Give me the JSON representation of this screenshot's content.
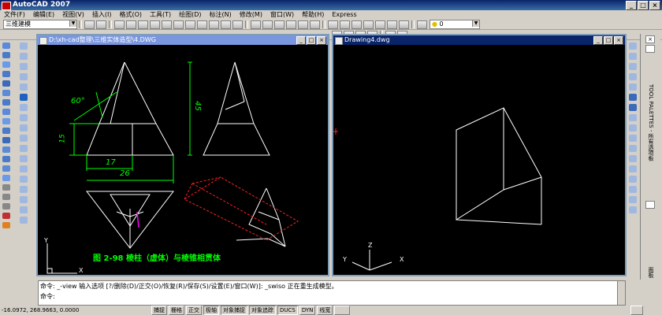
{
  "app": {
    "title": "AutoCAD 2007",
    "min": "_",
    "max": "□",
    "close": "×"
  },
  "menu": [
    "文件(F)",
    "编辑(E)",
    "视图(V)",
    "插入(I)",
    "格式(O)",
    "工具(T)",
    "绘图(D)",
    "标注(N)",
    "修改(M)",
    "窗口(W)",
    "帮助(H)",
    "Express"
  ],
  "toolbar": {
    "workspace": "三维建模",
    "layer": "0"
  },
  "drawing1": {
    "title": "D:\\xh-cad整理\\三维实体造型\\4.DWG",
    "caption": "图 2-98  棱柱（虚体）与棱锥相贯体",
    "dims": {
      "angle": "60°",
      "vertical_45": "45",
      "vertical_15": "15",
      "h17": "17",
      "h26": "26"
    },
    "ucs_y": "Y",
    "ucs_x": "X"
  },
  "drawing2": {
    "title": "Drawing4.dwg",
    "ucs_x": "X",
    "ucs_y": "Y",
    "ucs_z": "Z"
  },
  "right_panel": {
    "tool_palettes": "TOOL PALETTES - 所有选项板",
    "bottom_label": "面板"
  },
  "command": {
    "line1_prompt": "命令:",
    "line1_text": "_-view 输入选项 [?/删除(D)/正交(O)/恢复(R)/保存(S)/设置(E)/窗口(W)]: _swiso 正在重生成模型。",
    "line2_prompt": "命令:"
  },
  "status": {
    "coords": "-16.0972, 268.9663, 0.0000",
    "buttons": [
      "捕捉",
      "栅格",
      "正交",
      "极轴",
      "对象捕捉",
      "对象追踪",
      "DUCS",
      "DYN",
      "线宽"
    ]
  },
  "colors": {
    "dim_green": "#00ff00",
    "dashed_red": "#ff2020",
    "magenta": "#ff00ff",
    "mdi_active": "#0a246a",
    "mdi_inactive": "#7a96df"
  }
}
